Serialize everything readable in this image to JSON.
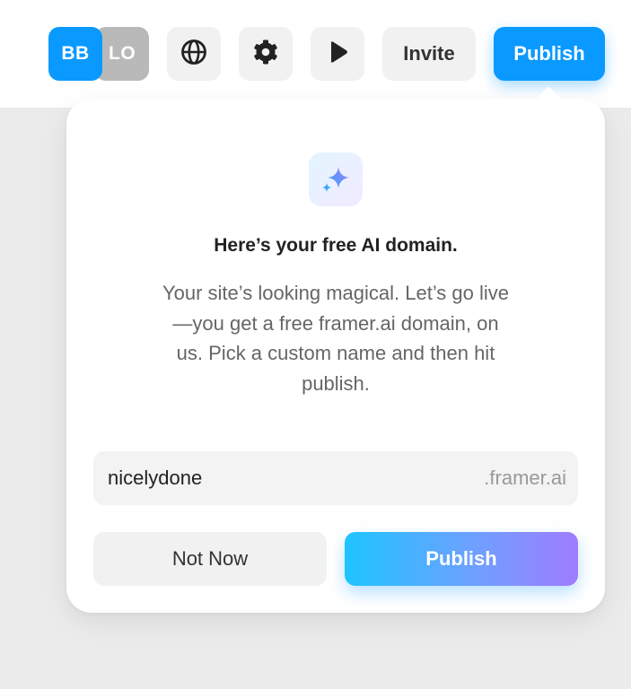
{
  "toolbar": {
    "avatars": [
      {
        "initials": "BB",
        "color": "#0a99ff"
      },
      {
        "initials": "LO",
        "color": "#b9b9b9"
      }
    ],
    "icons": [
      "globe-icon",
      "gear-icon",
      "play-icon"
    ],
    "invite_label": "Invite",
    "publish_label": "Publish",
    "accent_color": "#0a99ff"
  },
  "popover": {
    "icon": "sparkles-icon",
    "title": "Here’s your free AI domain.",
    "description": "Your site’s looking magical. Let’s go live—you get a free framer.ai domain, on us. Pick a custom name and then hit publish.",
    "domain": {
      "value": "nicelydone",
      "suffix": ".framer.ai"
    },
    "buttons": {
      "not_now_label": "Not Now",
      "publish_label": "Publish"
    },
    "publish_gradient": [
      "#1ec4ff",
      "#a07cff"
    ]
  }
}
